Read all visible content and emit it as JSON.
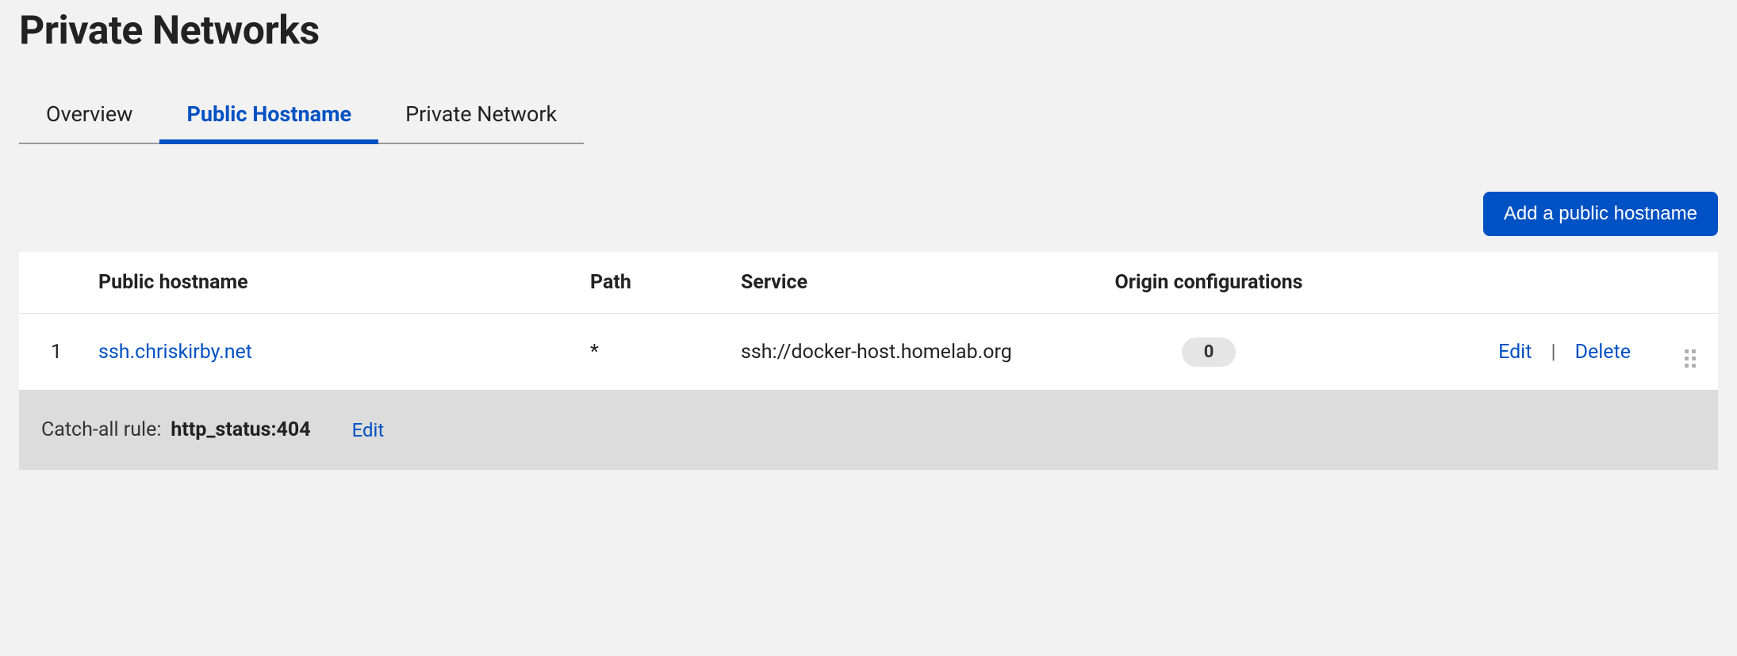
{
  "page": {
    "title": "Private Networks"
  },
  "tabs": [
    {
      "label": "Overview",
      "active": false
    },
    {
      "label": "Public Hostname",
      "active": true
    },
    {
      "label": "Private Network",
      "active": false
    }
  ],
  "actions": {
    "add_button": "Add a public hostname"
  },
  "table": {
    "headers": {
      "hostname": "Public hostname",
      "path": "Path",
      "service": "Service",
      "origin": "Origin configurations"
    },
    "rows": [
      {
        "index": "1",
        "hostname": "ssh.chriskirby.net",
        "path": "*",
        "service": "ssh://docker-host.homelab.org",
        "origin_count": "0",
        "edit": "Edit",
        "delete": "Delete"
      }
    ]
  },
  "catch_all": {
    "label": "Catch-all rule:",
    "value": "http_status:404",
    "edit": "Edit"
  }
}
